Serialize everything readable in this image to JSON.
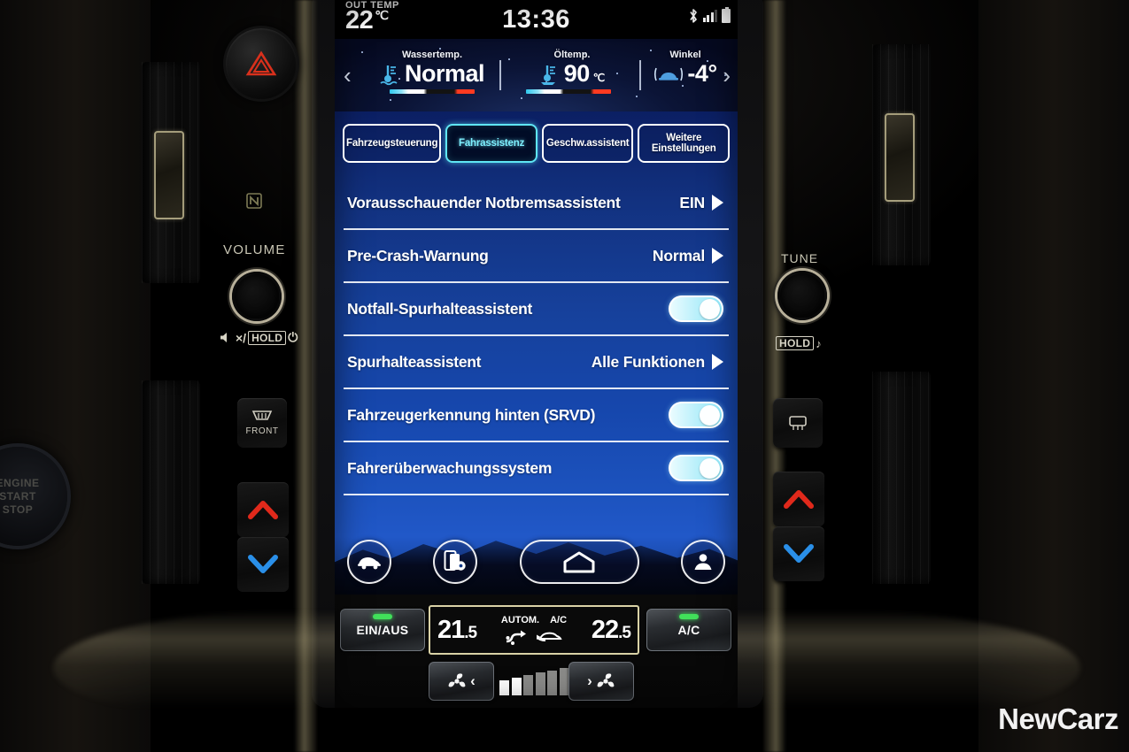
{
  "statusbar": {
    "out_temp_label": "OUT TEMP",
    "out_temp_value": "22",
    "out_temp_unit": "℃",
    "clock": "13:36",
    "icons": [
      "bluetooth-icon",
      "signal-icon",
      "battery-icon"
    ],
    "signal_bars_on": 3,
    "signal_bars_total": 4
  },
  "gauges": {
    "prev_arrow": "‹",
    "next_arrow": "›",
    "items": [
      {
        "label": "Wassertemp.",
        "value": "Normal",
        "unit": "",
        "icon": "water-temp-icon",
        "has_bar": true
      },
      {
        "label": "Öltemp.",
        "value": "90",
        "unit": "℃",
        "icon": "oil-temp-icon",
        "has_bar": true
      },
      {
        "label": "Winkel",
        "value": "-4°",
        "unit": "",
        "icon": "vehicle-tilt-icon",
        "has_bar": false
      }
    ]
  },
  "tabs": [
    {
      "label": "Fahrzeugsteuerung",
      "active": false
    },
    {
      "label": "Fahrassistenz",
      "active": true
    },
    {
      "label": "Geschw.assistent",
      "active": false
    },
    {
      "label": "Weitere Einstellungen",
      "active": false
    }
  ],
  "settings_rows": [
    {
      "label": "Vorausschauender Notbremsassistent",
      "type": "value",
      "value": "EIN"
    },
    {
      "label": "Pre-Crash-Warnung",
      "type": "value",
      "value": "Normal"
    },
    {
      "label": "Notfall-Spurhalteassistent",
      "type": "toggle",
      "value": "on"
    },
    {
      "label": "Spurhalteassistent",
      "type": "value",
      "value": "Alle Funktionen"
    },
    {
      "label": "Fahrzeugerkennung hinten (SRVD)",
      "type": "toggle",
      "value": "on"
    },
    {
      "label": "Fahrerüberwachungssystem",
      "type": "toggle",
      "value": "on"
    }
  ],
  "dock": [
    {
      "name": "vehicle-icon",
      "label": "Fahrzeug"
    },
    {
      "name": "apps-settings-icon",
      "label": "Apps"
    },
    {
      "name": "home-icon",
      "label": "Home"
    },
    {
      "name": "profile-icon",
      "label": "Profil"
    }
  ],
  "climate": {
    "onoff_label": "EIN/AUS",
    "onoff_led": "on",
    "ac_label": "A/C",
    "ac_led": "on",
    "temp_left": "21.5",
    "temp_right": "22.5",
    "mode_auto_label": "AUTOM.",
    "mode_ac_label": "A/C",
    "auto_icon": "airflow-icon",
    "ac_icon": "recirculation-icon",
    "fan_down_label": "‹",
    "fan_up_label": "›",
    "fan_icon": "fan-icon",
    "fan_level": 2,
    "fan_steps": 7
  },
  "hardware": {
    "hazard_label": "hazard-warning",
    "nfc_label": "N",
    "volume_label": "VOLUME",
    "tune_label": "TUNE",
    "mute_label": "×/",
    "hold_label": "HOLD",
    "power_label": "⏻",
    "hold_music_label": "HOLD",
    "front_defrost_label": "FRONT",
    "rear_defrost_label": "rear-defrost",
    "engine_start_l1": "ENGINE",
    "engine_start_l2": "START",
    "engine_start_l3": "STOP"
  },
  "watermark": "NewCarz",
  "colors": {
    "accent_cyan": "#7ef0ff",
    "panel_blue": "#1647ad",
    "led_green": "#41e05a",
    "hazard_red": "#d9301c",
    "temp_up_red": "#e0291b",
    "temp_down_blue": "#2a8fe8"
  }
}
